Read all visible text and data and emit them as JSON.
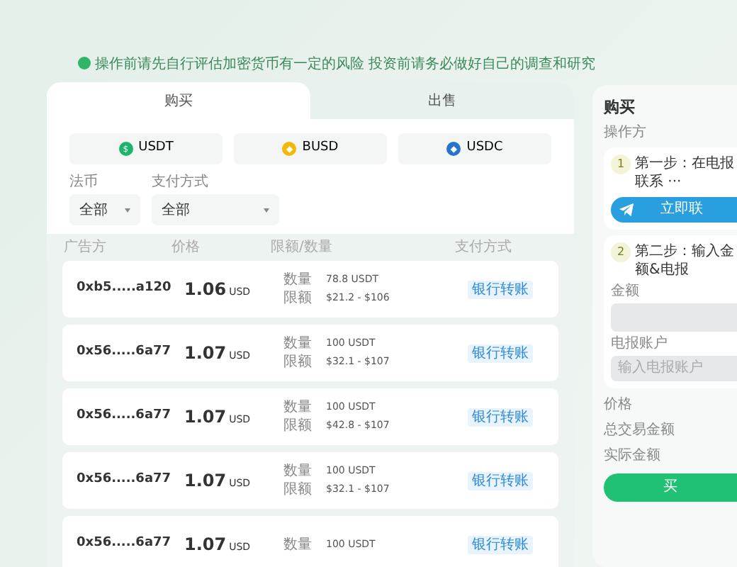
{
  "notice": "操作前请先自行评估加密货币有一定的风险 投资前请务必做好自己的调查和研究",
  "tabs": [
    {
      "label": "购买",
      "selected": true
    },
    {
      "label": "出售",
      "selected": false
    }
  ],
  "coins": [
    {
      "label": "USDT",
      "color": "#1db36b",
      "symbol": "$"
    },
    {
      "label": "BUSD",
      "color": "#f0b90b",
      "symbol": "◆"
    },
    {
      "label": "USDC",
      "color": "#2775ca",
      "symbol": "◆"
    }
  ],
  "filters": [
    {
      "label": "法币",
      "value": "全部"
    },
    {
      "label": "支付方式",
      "value": "全部"
    }
  ],
  "columns": [
    "广告方",
    "价格",
    "限额/数量",
    "支付方式"
  ],
  "rows": [
    {
      "advertiser": "0xb5.....a120",
      "price": "1.06",
      "currency": "USD",
      "qty_label": "数量",
      "limit_label": "限额",
      "qty": "78.8 USDT",
      "limit": "$21.2 - $106",
      "payment": "银行转账"
    },
    {
      "advertiser": "0x56.....6a77",
      "price": "1.07",
      "currency": "USD",
      "qty_label": "数量",
      "limit_label": "限额",
      "qty": "100 USDT",
      "limit": "$32.1 - $107",
      "payment": "银行转账"
    },
    {
      "advertiser": "0x56.....6a77",
      "price": "1.07",
      "currency": "USD",
      "qty_label": "数量",
      "limit_label": "限额",
      "qty": "100 USDT",
      "limit": "$42.8 - $107",
      "payment": "银行转账"
    },
    {
      "advertiser": "0x56.....6a77",
      "price": "1.07",
      "currency": "USD",
      "qty_label": "数量",
      "limit_label": "限额",
      "qty": "100 USDT",
      "limit": "$32.1 - $107",
      "payment": "银行转账"
    },
    {
      "advertiser": "0x56.....6a77",
      "price": "1.07",
      "currency": "USD",
      "qty_label": "数量",
      "qty": "100 USDT",
      "payment": "银行转账"
    }
  ],
  "panel": {
    "title": "购买",
    "subtitle": "操作方",
    "step1": {
      "number": "1",
      "text": "第一步：在电报联系 ···",
      "button": "立即联"
    },
    "step2": {
      "number": "2",
      "text": "第二步：输入金额&电报",
      "amount_label": "金额",
      "account_label": "电报账户",
      "account_placeholder": "输入电报账户"
    },
    "summary": [
      "价格",
      "总交易金额",
      "实际金额"
    ],
    "buy_button": "买"
  }
}
